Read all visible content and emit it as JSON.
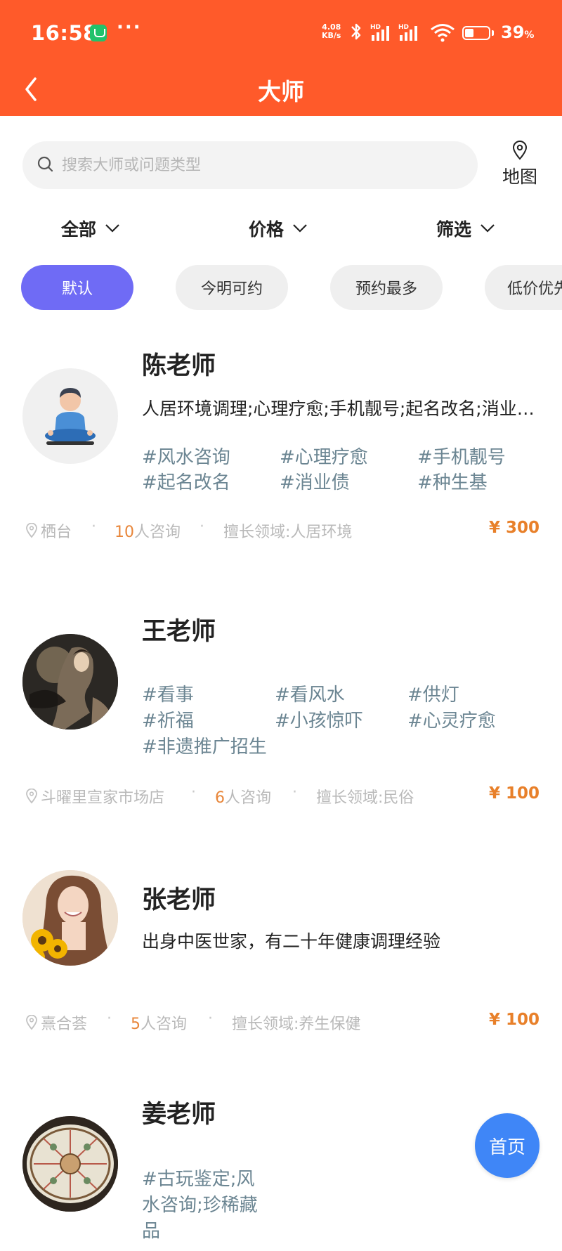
{
  "status_bar": {
    "time": "16:58",
    "more": "···",
    "net_speed": "4.08",
    "net_unit": "KB/s",
    "signal_label": "HD",
    "battery_percent": "39",
    "battery_unit": "%",
    "battery_level": 0.39
  },
  "nav": {
    "title": "大师"
  },
  "search": {
    "placeholder": "搜索大师或问题类型",
    "map_label": "地图"
  },
  "filters": [
    "全部",
    "价格",
    "筛选"
  ],
  "sort_chips": [
    "默认",
    "今明可约",
    "预约最多",
    "低价优先"
  ],
  "masters": [
    {
      "name": "陈老师",
      "desc": "人居环境调理;心理疗愈;手机靓号;起名改名;消业债;种生基",
      "tags": [
        "#风水咨询",
        "#心理疗愈",
        "#手机靓号",
        "#起名改名",
        "#消业债",
        "#种生基"
      ],
      "location": "栖台",
      "consult_count": "10",
      "consult_suffix": "人咨询",
      "field": "擅长领域:人居环境",
      "price": "¥ 300"
    },
    {
      "name": "王老师",
      "desc": "",
      "tags": [
        "#看事",
        "#看风水",
        "#供灯",
        "#祈福",
        "#小孩惊吓",
        "#心灵疗愈",
        "#非遗推广招生"
      ],
      "location": "斗曜里宣家市场店",
      "consult_count": "6",
      "consult_suffix": "人咨询",
      "field": "擅长领域:民俗",
      "price": "¥ 100"
    },
    {
      "name": "张老师",
      "desc": "出身中医世家，有二十年健康调理经验",
      "tags": [],
      "location": "熹合荟",
      "consult_count": "5",
      "consult_suffix": "人咨询",
      "field": "擅长领域:养生保健",
      "price": "¥ 100"
    },
    {
      "name": "姜老师",
      "desc": "",
      "tags_lines": [
        "#古玩鉴定;风",
        "水咨询;珍稀藏",
        "品"
      ]
    }
  ],
  "fab": {
    "label": "首页"
  },
  "colors": {
    "brand": "#ff5a2a",
    "active_chip": "#6f6bf5",
    "price": "#e8802a",
    "tag": "#6b8592",
    "fab": "#3f86f7"
  }
}
